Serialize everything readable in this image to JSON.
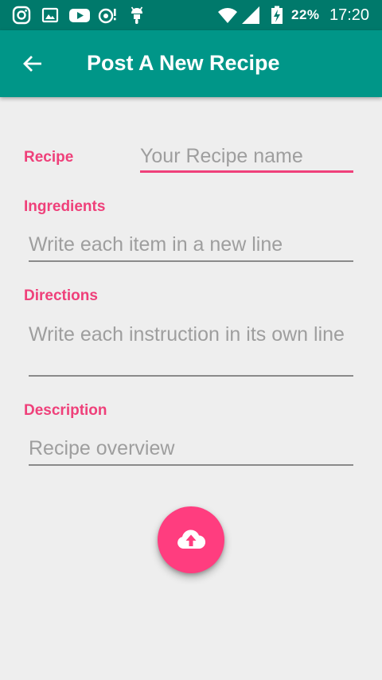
{
  "status_bar": {
    "battery_percent": "22%",
    "time": "17:20",
    "icons": [
      "instagram-icon",
      "gallery-icon",
      "youtube-icon",
      "hotspot-icon",
      "android-icon",
      "wifi-icon",
      "signal-icon",
      "battery-charging-icon"
    ]
  },
  "app_bar": {
    "title": "Post A New Recipe",
    "back_icon": "arrow-back-icon",
    "color": "#009688",
    "status_color": "#00796b"
  },
  "form": {
    "recipe": {
      "label": "Recipe",
      "placeholder": "Your Recipe name",
      "value": ""
    },
    "ingredients": {
      "label": "Ingredients",
      "placeholder": "Write each item in a new line",
      "value": ""
    },
    "directions": {
      "label": "Directions",
      "placeholder": "Write each instruction in its own line",
      "value": ""
    },
    "description": {
      "label": "Description",
      "placeholder": "Recipe overview",
      "value": ""
    }
  },
  "upload_button": {
    "icon": "cloud-upload-icon",
    "color": "#ff3d7f"
  },
  "colors": {
    "accent": "#ef407a",
    "background": "#eeeeee"
  }
}
